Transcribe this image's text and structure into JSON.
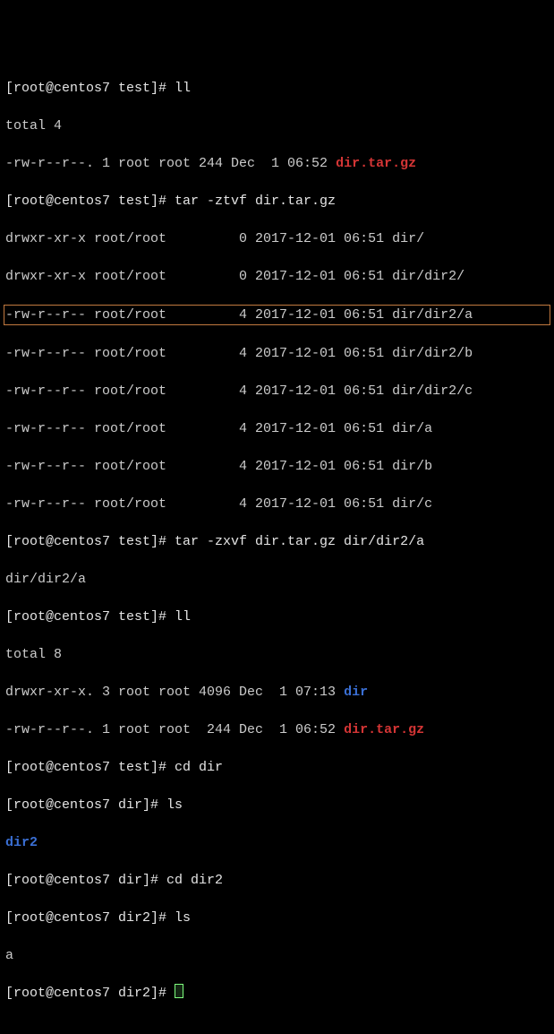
{
  "lines": {
    "l1_prompt": "[root@centos7 test]# ",
    "l1_cmd": "ll",
    "l2": "total 4",
    "l3a": "-rw-r--r--. 1 root root 244 Dec  1 06:52 ",
    "l3b": "dir.tar.gz",
    "l4_prompt": "[root@centos7 test]# ",
    "l4_cmd": "tar -ztvf dir.tar.gz",
    "l5": "drwxr-xr-x root/root         0 2017-12-01 06:51 dir/",
    "l6": "drwxr-xr-x root/root         0 2017-12-01 06:51 dir/dir2/",
    "l7": "-rw-r--r-- root/root         4 2017-12-01 06:51 dir/dir2/a",
    "l8": "-rw-r--r-- root/root         4 2017-12-01 06:51 dir/dir2/b",
    "l9": "-rw-r--r-- root/root         4 2017-12-01 06:51 dir/dir2/c",
    "l10": "-rw-r--r-- root/root         4 2017-12-01 06:51 dir/a",
    "l11": "-rw-r--r-- root/root         4 2017-12-01 06:51 dir/b",
    "l12": "-rw-r--r-- root/root         4 2017-12-01 06:51 dir/c",
    "l13_prompt": "[root@centos7 test]# ",
    "l13_cmd": "tar -zxvf dir.tar.gz dir/dir2/a",
    "l14": "dir/dir2/a",
    "l15_prompt": "[root@centos7 test]# ",
    "l15_cmd": "ll",
    "l16": "total 8",
    "l17a": "drwxr-xr-x. 3 root root 4096 Dec  1 07:13 ",
    "l17b": "dir",
    "l18a": "-rw-r--r--. 1 root root  244 Dec  1 06:52 ",
    "l18b": "dir.tar.gz",
    "l19_prompt": "[root@centos7 test]# ",
    "l19_cmd": "cd dir",
    "l20_prompt": "[root@centos7 dir]# ",
    "l20_cmd": "ls",
    "l21": "dir2",
    "l22_prompt": "[root@centos7 dir]# ",
    "l22_cmd": "cd dir2",
    "l23_prompt": "[root@centos7 dir2]# ",
    "l23_cmd": "ls",
    "l24": "a",
    "l25_prompt": "[root@centos7 dir2]# "
  }
}
